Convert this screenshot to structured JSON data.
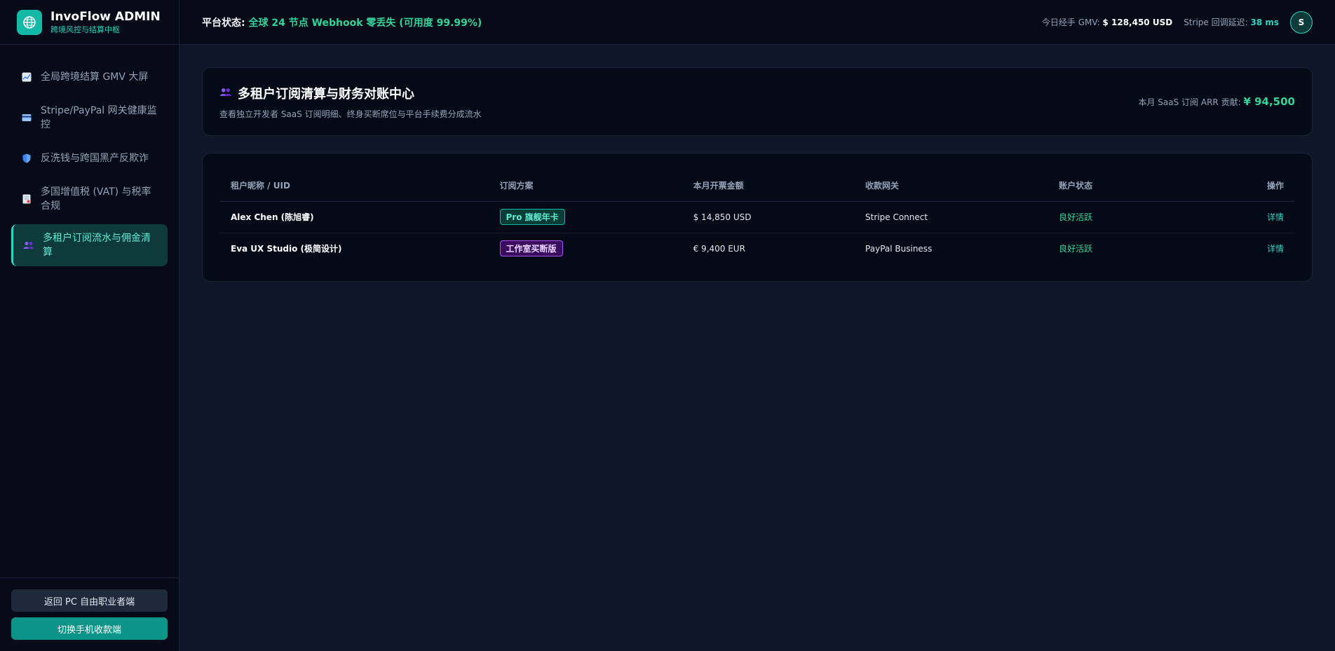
{
  "brand": {
    "title": "InvoFlow ADMIN",
    "subtitle": "跨境风控与结算中枢"
  },
  "sidebar": {
    "items": [
      {
        "label": "全局跨境结算 GMV 大屏",
        "icon": "chart-icon"
      },
      {
        "label": "Stripe/PayPal 网关健康监控",
        "icon": "card-icon"
      },
      {
        "label": "反洗钱与跨国黑产反欺诈",
        "icon": "shield-icon"
      },
      {
        "label": "多国增值税 (VAT) 与税率合规",
        "icon": "document-icon"
      },
      {
        "label": "多租户订阅流水与佣金清算",
        "icon": "users-icon",
        "active": true
      }
    ],
    "footer": {
      "back_label": "返回 PC 自由职业者端",
      "switch_label": "切换手机收款端"
    }
  },
  "topbar": {
    "status_prefix": "平台状态:",
    "status_text": "全球 24 节点 Webhook 零丢失 (可用度 99.99%)",
    "gmv_label": "今日经手 GMV:",
    "gmv_value": "$ 128,450 USD",
    "latency_label": "Stripe 回调延迟:",
    "latency_value": "38 ms",
    "avatar": "S"
  },
  "page": {
    "title": "多租户订阅清算与财务对账中心",
    "subtitle": "查看独立开发者 SaaS 订阅明细、终身买断席位与平台手续费分成流水",
    "arr_label": "本月 SaaS 订阅 ARR 贡献:",
    "arr_value": "¥ 94,500"
  },
  "table": {
    "headers": [
      "租户昵称 / UID",
      "订阅方案",
      "本月开票金额",
      "收款网关",
      "账户状态",
      "操作"
    ],
    "rows": [
      {
        "name": "Alex Chen (陈旭睿)",
        "plan": "Pro 旗舰年卡",
        "amount": "$ 14,850 USD",
        "gateway": "Stripe Connect",
        "status": "良好活跃",
        "action": "详情"
      },
      {
        "name": "Eva UX Studio (极简设计)",
        "plan": "工作室买断版",
        "amount": "€ 9,400 EUR",
        "gateway": "PayPal Business",
        "status": "良好活跃",
        "action": "详情"
      }
    ]
  },
  "colors": {
    "accent": "#14b8a6",
    "success": "#34d399",
    "purple": "#a855f7"
  }
}
